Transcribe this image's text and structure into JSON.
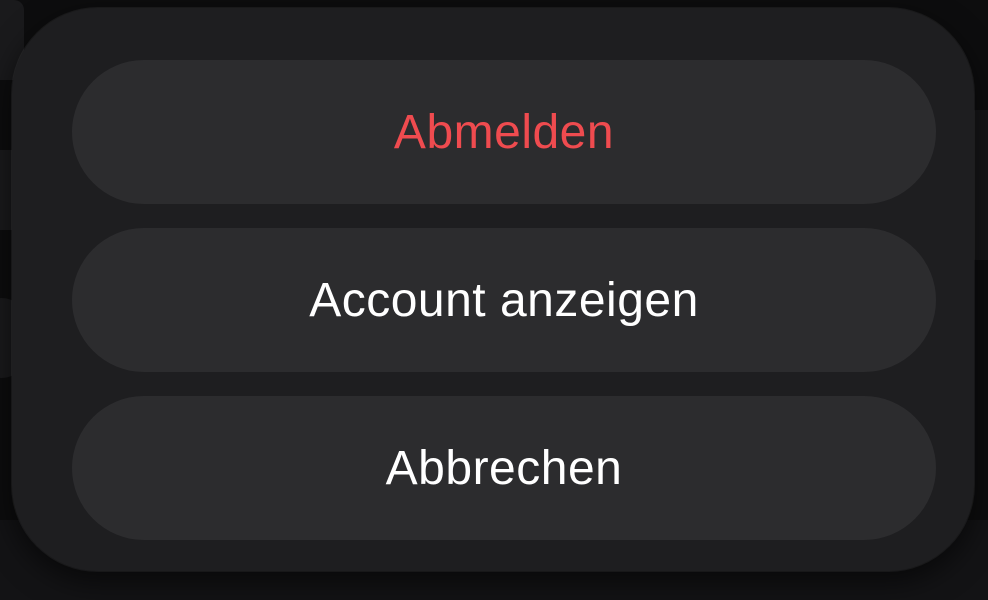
{
  "action_sheet": {
    "actions": [
      {
        "label": "Abmelden",
        "role": "destructive",
        "color": "#ef4b4f"
      },
      {
        "label": "Account anzeigen",
        "role": "default",
        "color": "#ffffff"
      },
      {
        "label": "Abbrechen",
        "role": "cancel",
        "color": "#ffffff"
      }
    ]
  },
  "theme": {
    "sheet_background": "#1e1e20",
    "button_background": "#2c2c2e",
    "destructive_color": "#ef4b4f"
  }
}
